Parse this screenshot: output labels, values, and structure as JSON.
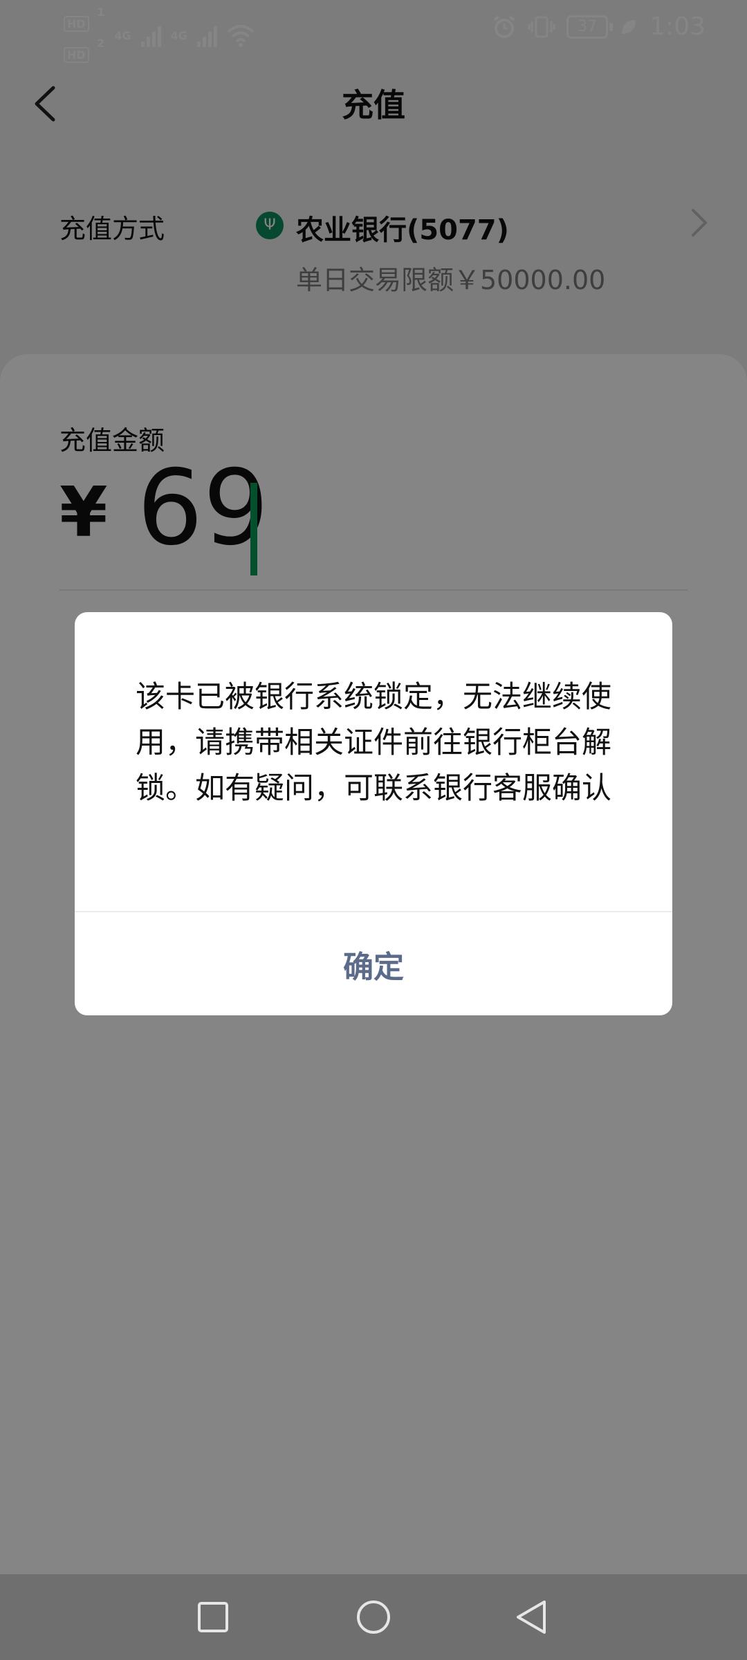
{
  "status_bar": {
    "sim1_label": "HD",
    "sim1_index": "1",
    "sim2_label": "HD",
    "sim2_index": "2",
    "network1": "4G",
    "network2": "4G",
    "battery": "37",
    "time": "1:03"
  },
  "header": {
    "title": "充值",
    "back_icon": "chevron-left-icon"
  },
  "method": {
    "label": "充值方式",
    "bank_name": "农业银行(5077)",
    "limit": "单日交易限额￥50000.00",
    "chevron": "chevron-right-icon"
  },
  "amount": {
    "label": "充值金额",
    "currency": "¥",
    "value": "69"
  },
  "dialog": {
    "message": "该卡已被银行系统锁定，无法继续使用，请携带相关证件前往银行柜台解锁。如有疑问，可联系银行客服确认",
    "confirm_label": "确定"
  },
  "nav": {
    "recent_icon": "square-icon",
    "home_icon": "circle-icon",
    "back_icon": "triangle-back-icon"
  },
  "colors": {
    "accent": "#0a9856",
    "dialog_button": "#5c6b8a",
    "overlay": "rgba(0,0,0,0.48)"
  }
}
